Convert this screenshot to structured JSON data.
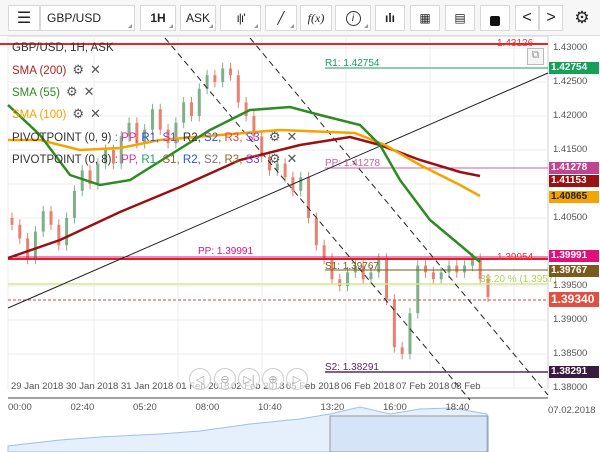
{
  "toolbar": {
    "menu_icon": "hamburger-icon",
    "symbol": "GBP/USD",
    "timeframe": "1H",
    "price_side": "ASK",
    "chart_type_icon": "candles-icon",
    "draw_icon": "pencil-icon",
    "indicator_label": "f(x)",
    "info_icon": "info-icon",
    "volume_icon": "bar-chart-icon",
    "calendar_icon": "calendar-icon",
    "report_icon": "report-icon",
    "lock_icon": "lock-icon",
    "prev": "<",
    "next": ">",
    "settings_icon": "gear-icon"
  },
  "legend": {
    "title": "GBP/USD, 1H, ASK",
    "indicators": [
      {
        "label": "SMA (200)",
        "color": "#b22222"
      },
      {
        "label": "SMA (55)",
        "color": "#2e8b22"
      },
      {
        "label": "SMA (100)",
        "color": "#f5a300"
      }
    ],
    "pivots": [
      {
        "label": "PIVOTPOINT (0, 9)",
        "parts": [
          ": PP,",
          "R1,",
          "S1,",
          "R2,",
          "S2,",
          "R3,",
          "S3"
        ],
        "colors": [
          "#e0309a",
          "#3050d0",
          "#9040d0",
          "#333",
          "#3050d0",
          "#e04040",
          "#9040d0"
        ]
      },
      {
        "label": "PIVOTPOINT (0, 8)",
        "parts": [
          ": PP,",
          "R1,",
          "S1,",
          "R2,",
          "S2,",
          "R3,",
          "S3"
        ],
        "colors": [
          "#e0309a",
          "#20a070",
          "#8b6a2a",
          "#3050d0",
          "#777",
          "#8b6a2a",
          "#9040d0"
        ]
      }
    ]
  },
  "lines": {
    "high": "1.43126",
    "r1": "R1: 1.42754",
    "pp": "PP: 1.41278",
    "pp_line": "PP: 1.39991",
    "red_line": "1.39954",
    "s1": "S1: 1.39767",
    "fib": "38.20 % (1.3957)",
    "s2": "S2: 1.38291"
  },
  "price_axis": {
    "ticks": [
      "1.43000",
      "1.42500",
      "1.42000",
      "1.41500",
      "1.41000",
      "1.40500",
      "1.39500",
      "1.39000",
      "1.38500",
      "1.38000"
    ],
    "badges": [
      {
        "v": "1.42754",
        "c": "#16a05a"
      },
      {
        "v": "1.41278",
        "c": "#c0448f"
      },
      {
        "v": "1.41153",
        "c": "#9b1010"
      },
      {
        "v": "1.40865",
        "c": "#f5a300"
      },
      {
        "v": "1.39991",
        "c": "#e0107a"
      },
      {
        "v": "1.39767",
        "c": "#7a5a1e"
      },
      {
        "v": "1.39340",
        "c": "#e05040"
      },
      {
        "v": "1.38291",
        "c": "#3a1a40"
      }
    ]
  },
  "date_axis": [
    "29 Jan 2018",
    "30 Jan 2018",
    "31 Jan 2018",
    "01 Feb 2018",
    "02 Feb 2018",
    "05 Feb 2018",
    "06 Feb 2018",
    "07 Feb 2018",
    "08 Feb"
  ],
  "time_axis": [
    "00:00",
    "02:40",
    "05:20",
    "08:00",
    "10:40",
    "13:20",
    "16:00",
    "18:40"
  ],
  "nav_date": "07.02.2018",
  "chart_data": {
    "type": "candlestick",
    "closes": [
      1.404,
      1.402,
      1.399,
      1.403,
      1.406,
      1.404,
      1.401,
      1.405,
      1.409,
      1.412,
      1.41,
      1.413,
      1.415,
      1.413,
      1.417,
      1.419,
      1.416,
      1.418,
      1.421,
      1.418,
      1.416,
      1.419,
      1.422,
      1.42,
      1.424,
      1.426,
      1.425,
      1.427,
      1.426,
      1.422,
      1.42,
      1.417,
      1.414,
      1.412,
      1.413,
      1.411,
      1.409,
      1.411,
      1.405,
      1.401,
      1.399,
      1.396,
      1.395,
      1.397,
      1.398,
      1.396,
      1.397,
      1.399,
      1.393,
      1.386,
      1.385,
      1.391,
      1.398,
      1.397,
      1.396,
      1.397,
      1.398,
      1.397,
      1.398,
      1.399,
      1.396,
      1.3934
    ],
    "current": "1.39340"
  }
}
